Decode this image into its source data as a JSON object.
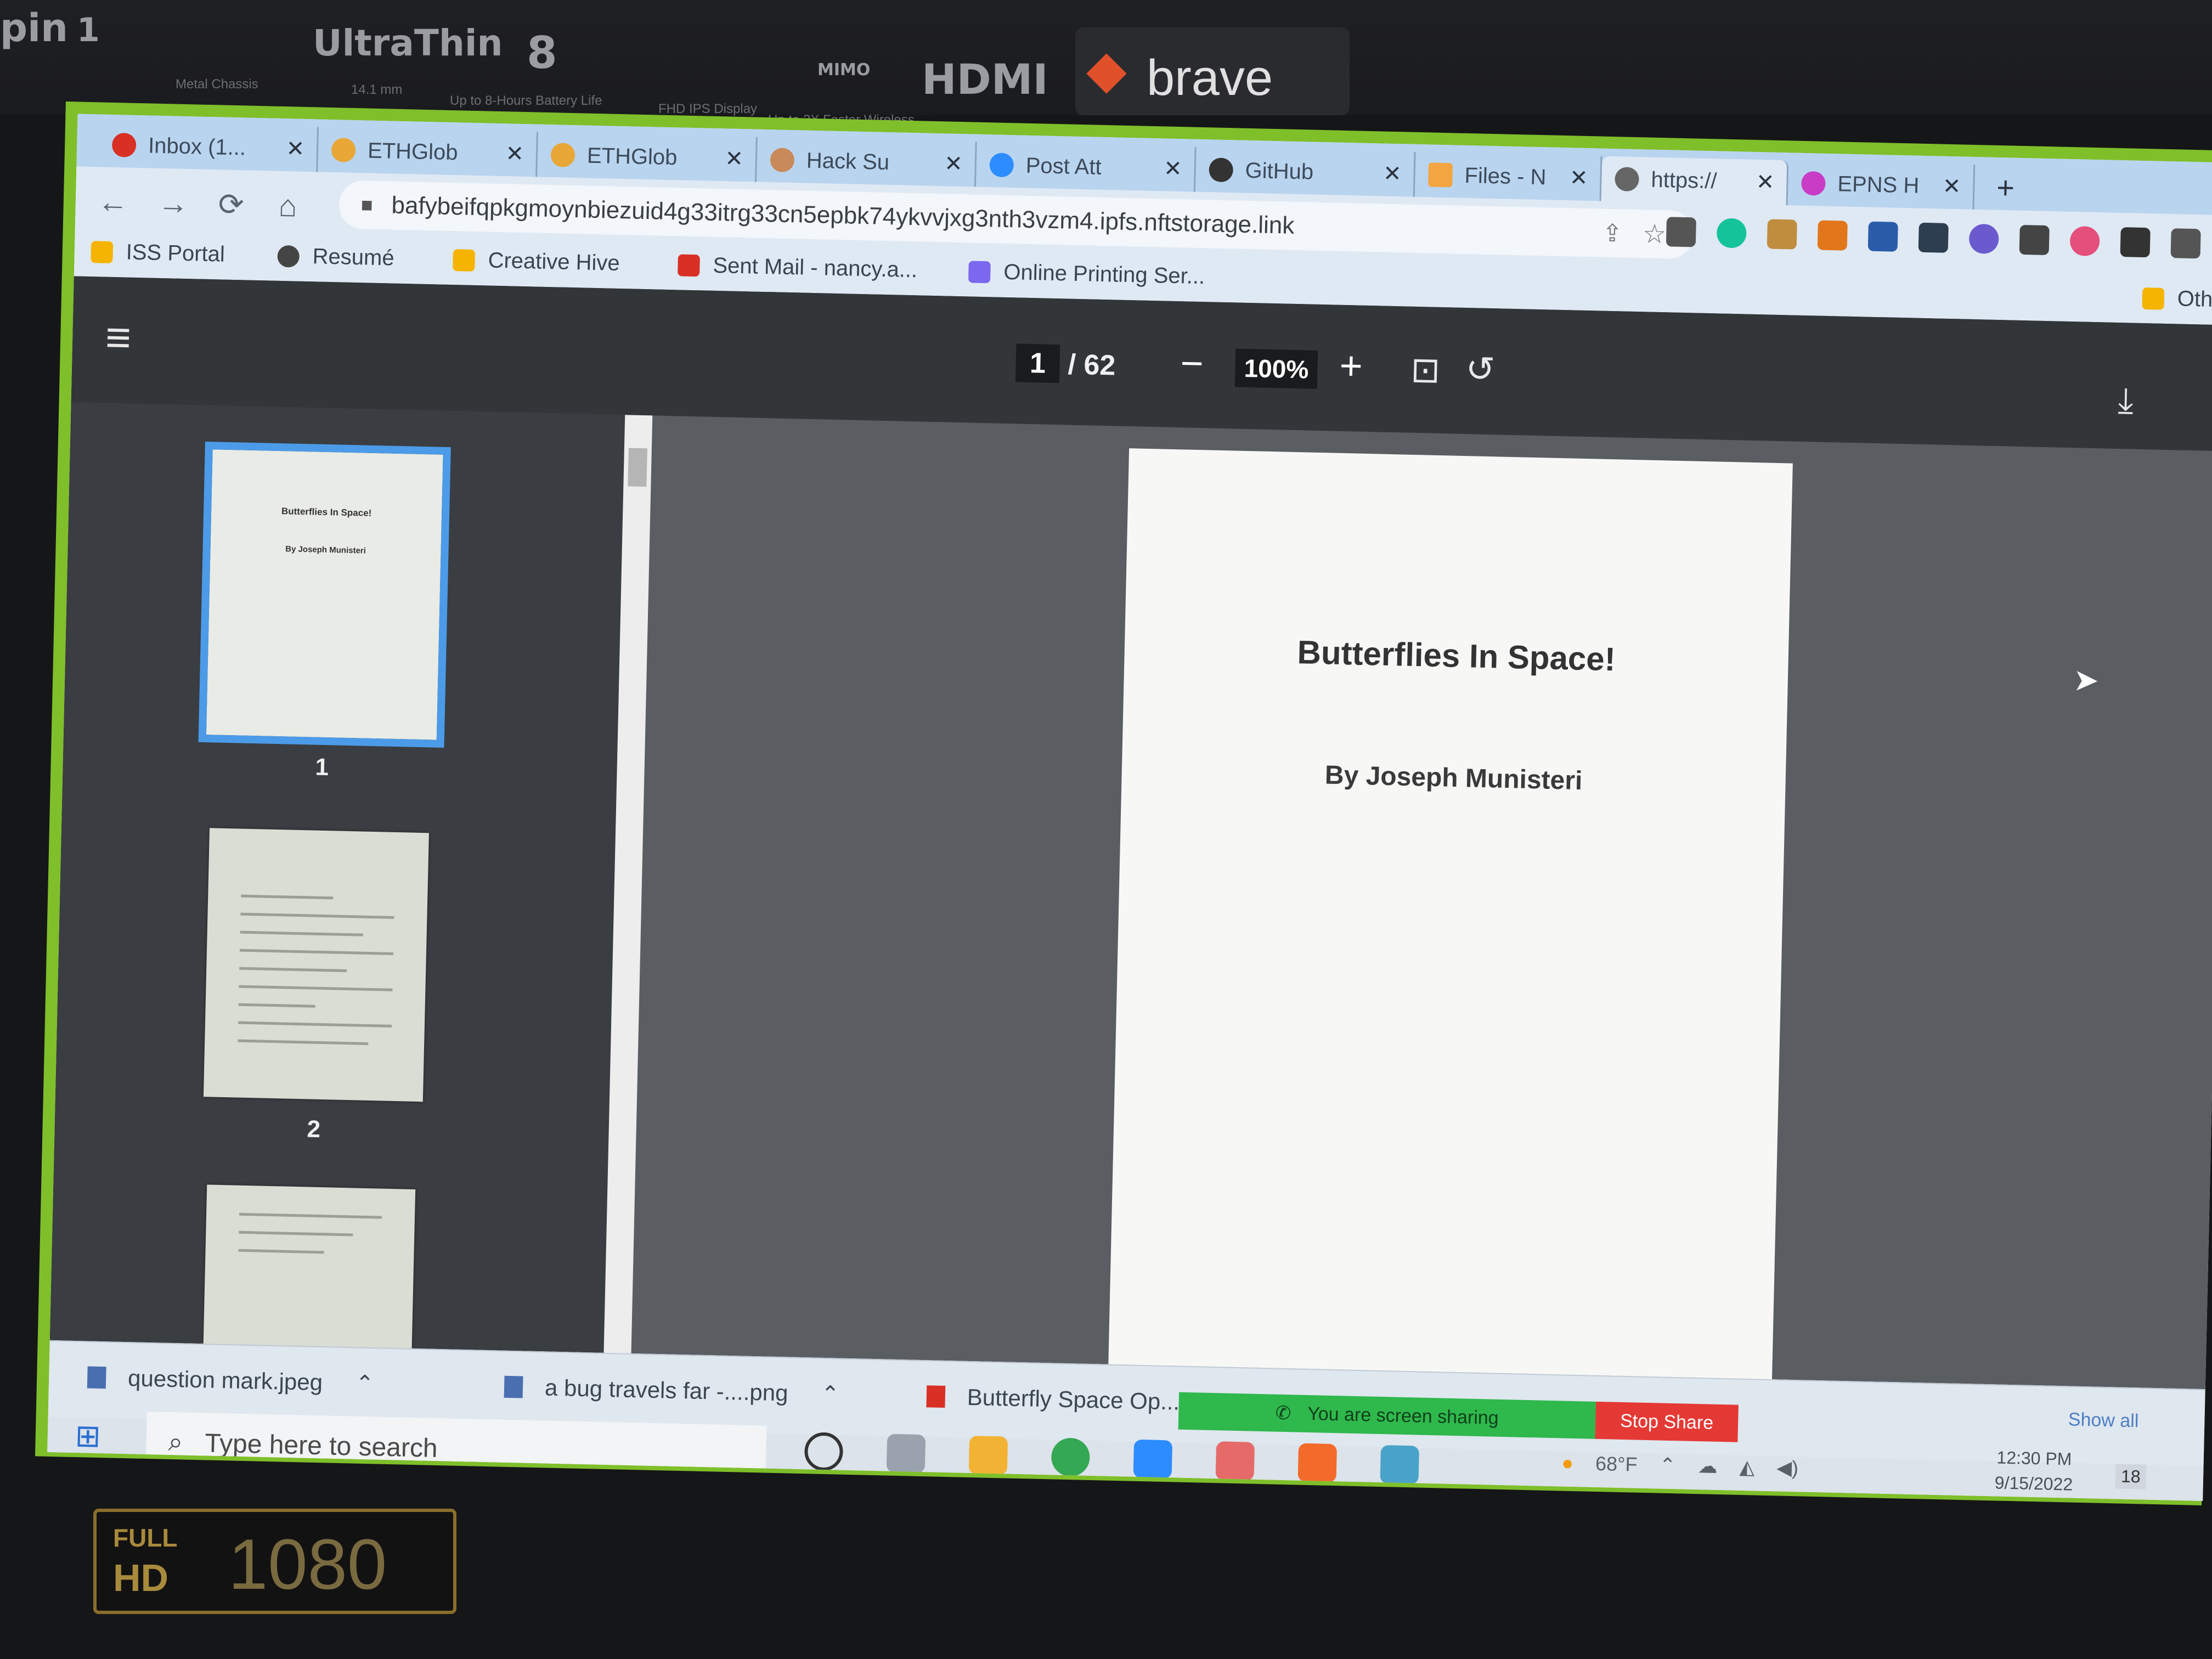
{
  "bezel": {
    "stickers": {
      "partial": "pin",
      "partial_num": "1",
      "chassis": "Metal Chassis",
      "ultrathin": "UltraThin",
      "thickness": "14.1 mm",
      "battery_num": "8",
      "battery": "Up to 8-Hours Battery Life",
      "display": "FHD IPS Display",
      "wireless": "Up to 2X Faster Wireless",
      "mimo": "MIMO",
      "hdmi": "HDMI",
      "brave": "brave"
    },
    "badge": {
      "full": "FULL",
      "hd": "HD",
      "res": "1080"
    }
  },
  "browser": {
    "tabs": [
      {
        "label": "Inbox (1...",
        "icon": "gmail-icon",
        "color": "#d93025"
      },
      {
        "label": "ETHGlob",
        "icon": "ethglobal-icon",
        "color": "#e8a736"
      },
      {
        "label": "ETHGlob",
        "icon": "ethglobal-icon",
        "color": "#e8a736"
      },
      {
        "label": "Hack Su",
        "icon": "avatar-icon",
        "color": "#c98a5a"
      },
      {
        "label": "Post Att",
        "icon": "zoom-icon",
        "color": "#2d8cff"
      },
      {
        "label": "GitHub",
        "icon": "github-icon",
        "color": "#333333"
      },
      {
        "label": "Files - N",
        "icon": "files-icon",
        "color": "#f2a541"
      },
      {
        "label": "https://",
        "icon": "globe-icon",
        "color": "#666666"
      },
      {
        "label": "EPNS H",
        "icon": "epns-icon",
        "color": "#c93cc6"
      }
    ],
    "new_tab": "+",
    "nav": {
      "back": "←",
      "forward": "→",
      "reload": "⟳",
      "home": "⌂"
    },
    "url": "bafybeifqpkgmoynbiezuid4g33itrg33cn5epbk74ykvvjxg3nth3vzm4.ipfs.nftstorage.link",
    "bookmarks": [
      {
        "label": "ISS Portal",
        "color": "#f4b400"
      },
      {
        "label": "Resumé",
        "color": "#444444"
      },
      {
        "label": "Creative Hive",
        "color": "#f4b400"
      },
      {
        "label": "Sent Mail - nancy.a...",
        "color": "#d93025"
      },
      {
        "label": "Online Printing Ser...",
        "color": "#7b68ee"
      }
    ],
    "other_bookmarks": "Othe"
  },
  "pdf": {
    "current_page": "1",
    "total_pages": "/ 62",
    "zoom": "100%",
    "thumbnails": [
      {
        "label": "1",
        "title": "Butterflies In Space!",
        "author": "By Joseph Munisteri"
      },
      {
        "label": "2"
      }
    ],
    "page": {
      "title": "Butterflies In Space!",
      "author": "By Joseph Munisteri"
    }
  },
  "downloads": {
    "items": [
      {
        "label": "question mark.jpeg"
      },
      {
        "label": "a bug travels far -....png"
      },
      {
        "label": "Butterfly Space Op..."
      }
    ],
    "show_all": "Show all"
  },
  "screen_share": {
    "message": "You are screen sharing",
    "stop": "Stop Share"
  },
  "taskbar": {
    "search_placeholder": "Type here to search",
    "weather": "68°F",
    "time": "12:30 PM",
    "date": "9/15/2022",
    "notifications": "18"
  }
}
